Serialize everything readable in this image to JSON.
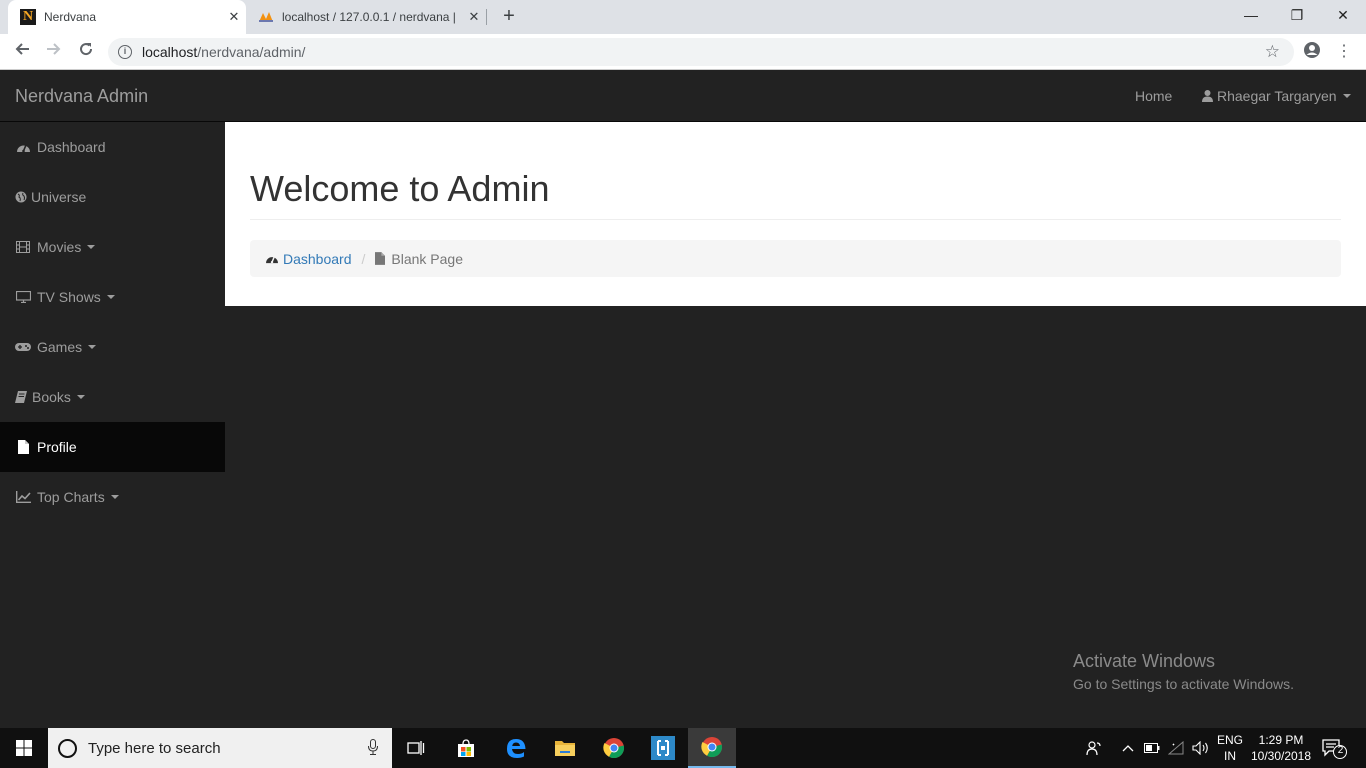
{
  "browser": {
    "tabs": [
      {
        "title": "Nerdvana",
        "favicon": "N",
        "active": true
      },
      {
        "title": "localhost / 127.0.0.1 / nerdvana |",
        "favicon": "phpmyadmin-icon",
        "active": false
      }
    ],
    "url_host": "localhost",
    "url_path": "/nerdvana/admin/"
  },
  "navbar": {
    "brand": "Nerdvana Admin",
    "home_label": "Home",
    "user_label": "Rhaegar Targaryen"
  },
  "sidebar": {
    "items": [
      {
        "label": "Dashboard",
        "icon": "dashboard-icon",
        "dropdown": false,
        "active": false
      },
      {
        "label": "Universe",
        "icon": "globe-icon",
        "dropdown": false,
        "active": false
      },
      {
        "label": "Movies",
        "icon": "film-icon",
        "dropdown": true,
        "active": false
      },
      {
        "label": "TV Shows",
        "icon": "desktop-icon",
        "dropdown": true,
        "active": false
      },
      {
        "label": "Games",
        "icon": "gamepad-icon",
        "dropdown": true,
        "active": false
      },
      {
        "label": "Books",
        "icon": "book-icon",
        "dropdown": true,
        "active": false
      },
      {
        "label": "Profile",
        "icon": "file-icon",
        "dropdown": false,
        "active": true
      },
      {
        "label": "Top Charts",
        "icon": "line-chart-icon",
        "dropdown": true,
        "active": false
      }
    ]
  },
  "main": {
    "heading": "Welcome to Admin",
    "breadcrumb": {
      "link_label": "Dashboard",
      "current_label": "Blank Page"
    }
  },
  "watermark": {
    "line1": "Activate Windows",
    "line2": "Go to Settings to activate Windows."
  },
  "taskbar": {
    "search_placeholder": "Type here to search",
    "lang_line1": "ENG",
    "lang_line2": "IN",
    "time": "1:29 PM",
    "date": "10/30/2018",
    "notification_count": "2"
  },
  "colors": {
    "navbar_bg": "#222222",
    "active_item_bg": "#080808",
    "link": "#337ab7",
    "nav_text": "#9d9d9d"
  }
}
